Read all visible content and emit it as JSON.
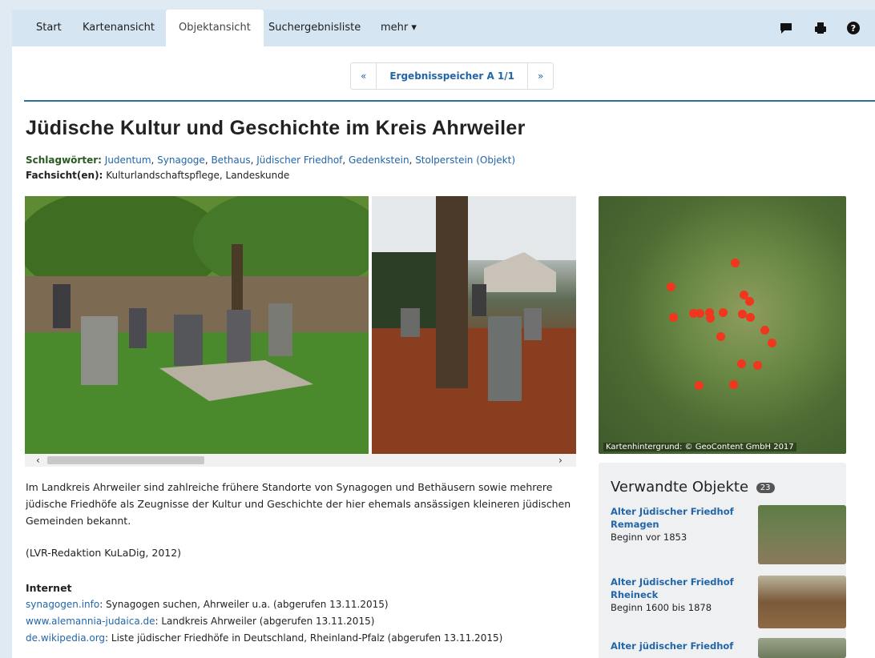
{
  "nav": {
    "tabs": [
      {
        "label": "Start"
      },
      {
        "label": "Kartenansicht"
      },
      {
        "label": "Objektansicht"
      },
      {
        "label": "Suchergebnisliste"
      },
      {
        "label": "mehr ▾"
      }
    ],
    "active_tab": "Objektansicht",
    "icons": [
      "comment-icon",
      "print-icon",
      "help-icon"
    ]
  },
  "pager": {
    "prev": "«",
    "label": "Ergebnisspeicher A 1/1",
    "next": "»"
  },
  "page": {
    "title": "Jüdische Kultur und Geschichte im Kreis Ahrweiler",
    "keywords_label": "Schlagwörter:",
    "keywords": [
      "Judentum",
      "Synagoge",
      "Bethaus",
      "Jüdischer Friedhof",
      "Gedenkstein",
      "Stolperstein (Objekt)"
    ],
    "fachsicht_label": "Fachsicht(en):",
    "fachsicht_value": "Kulturlandschaftspflege, Landeskunde"
  },
  "gallery": {
    "scroll_left": "‹",
    "scroll_right": "›"
  },
  "map": {
    "credit": "Kartenhintergrund: © GeoContent GmbH 2017"
  },
  "description": {
    "text": "Im Landkreis Ahrweiler sind zahlreiche frühere Standorte von Synagogen und Bethäusern sowie mehrere jüdische Friedhöfe als Zeugnisse der Kultur und Geschichte der hier ehemals ansässigen kleineren jüdischen Gemeinden bekannt.",
    "reference": "(LVR-Redaktion KuLaDig, 2012)"
  },
  "internet": {
    "heading": "Internet",
    "links": [
      {
        "link": "synagogen.info",
        "text": ": Synagogen suchen, Ahrweiler u.a. (abgerufen 13.11.2015)"
      },
      {
        "link": "www.alemannia-judaica.de",
        "text": ": Landkreis Ahrweiler (abgerufen 13.11.2015)"
      },
      {
        "link": "de.wikipedia.org",
        "text": ": Liste jüdischer Friedhöfe in Deutschland, Rheinland-Pfalz (abgerufen 13.11.2015)"
      }
    ]
  },
  "related": {
    "heading": "Verwandte Objekte",
    "count": "23",
    "items": [
      {
        "title_line1": "Alter Jüdischer Friedhof",
        "title_line2": "Remagen",
        "date": "Beginn vor 1853"
      },
      {
        "title_line1": "Alter Jüdischer Friedhof",
        "title_line2": "Rheineck",
        "date": "Beginn 1600 bis 1878"
      },
      {
        "title_line1": "Alter jüdischer Friedhof",
        "title_line2": "",
        "date": ""
      }
    ]
  }
}
